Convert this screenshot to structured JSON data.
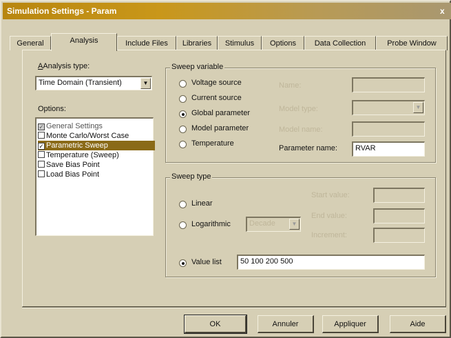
{
  "window": {
    "title": "Simulation Settings - Param",
    "close_label": "x"
  },
  "tabs": [
    {
      "label": "General"
    },
    {
      "label": "Analysis",
      "active": true
    },
    {
      "label": "Include Files"
    },
    {
      "label": "Libraries"
    },
    {
      "label": "Stimulus"
    },
    {
      "label": "Options"
    },
    {
      "label": "Data Collection"
    },
    {
      "label": "Probe Window"
    }
  ],
  "analysis": {
    "analysis_type_label": "Analysis type:",
    "analysis_type_value": "Time Domain (Transient)",
    "options_label": "Options:",
    "options": [
      {
        "label": "General Settings",
        "checked": true,
        "grayed": true
      },
      {
        "label": "Monte Carlo/Worst Case",
        "checked": false
      },
      {
        "label": "Parametric Sweep",
        "checked": true,
        "selected": true
      },
      {
        "label": "Temperature (Sweep)",
        "checked": false
      },
      {
        "label": "Save Bias Point",
        "checked": false
      },
      {
        "label": "Load Bias Point",
        "checked": false
      }
    ]
  },
  "sweep_variable": {
    "group_label": "Sweep variable",
    "radios": [
      {
        "label": "Voltage source",
        "selected": false
      },
      {
        "label": "Current source",
        "selected": false
      },
      {
        "label": "Global parameter",
        "selected": true
      },
      {
        "label": "Model parameter",
        "selected": false
      },
      {
        "label": "Temperature",
        "selected": false
      }
    ],
    "name_label": "Name:",
    "model_type_label": "Model type:",
    "model_name_label": "Model name:",
    "parameter_name_label": "Parameter name:",
    "parameter_name_value": "RVAR"
  },
  "sweep_type": {
    "group_label": "Sweep type",
    "linear_label": "Linear",
    "logarithmic_label": "Logarithmic",
    "logarithmic_combo": "Decade",
    "value_list_label": "Value list",
    "value_list_value": "50 100 200 500",
    "start_value_label": "Start value:",
    "end_value_label": "End value:",
    "increment_label": "Increment:",
    "selected": "value_list"
  },
  "buttons": {
    "ok": "OK",
    "cancel": "Annuler",
    "apply": "Appliquer",
    "help": "Aide"
  }
}
